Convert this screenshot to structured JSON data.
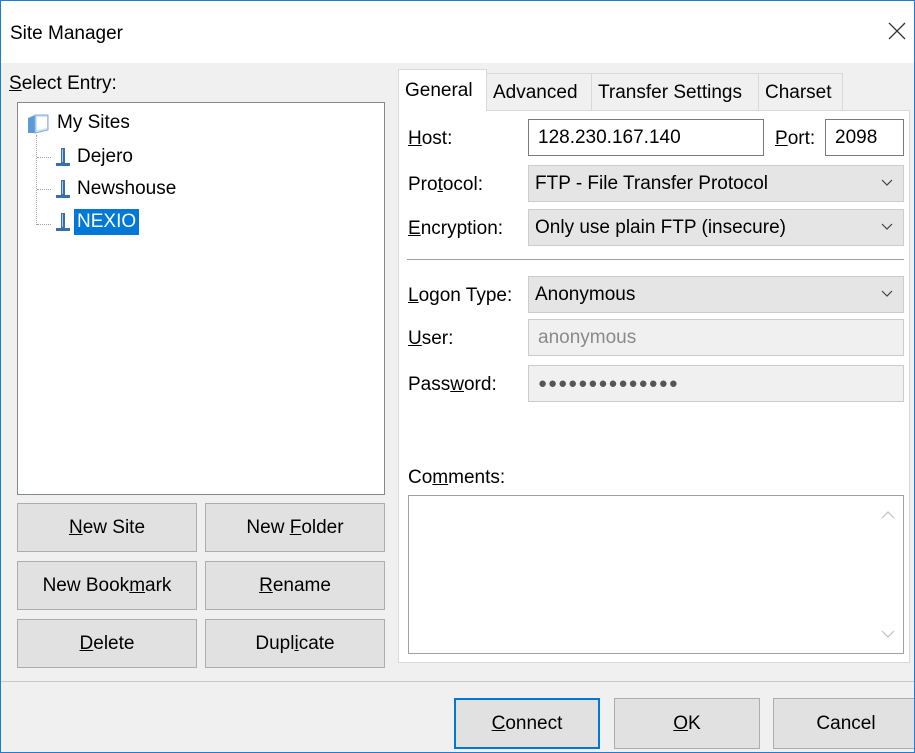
{
  "window": {
    "title": "Site Manager"
  },
  "left": {
    "select_entry_prefix": "S",
    "select_entry_rest": "elect Entry:",
    "tree": {
      "root": "My Sites",
      "items": [
        "Dejero",
        "Newshouse",
        "NEXIO"
      ],
      "selected": "NEXIO"
    },
    "buttons": {
      "new_site_u": "N",
      "new_site_rest": "ew Site",
      "new_folder_pre": "New ",
      "new_folder_u": "F",
      "new_folder_rest": "older",
      "new_bookmark_pre": "New Book",
      "new_bookmark_u": "m",
      "new_bookmark_rest": "ark",
      "rename_u": "R",
      "rename_rest": "ename",
      "delete_u": "D",
      "delete_rest": "elete",
      "duplicate_pre": "Dupl",
      "duplicate_u": "i",
      "duplicate_rest": "cate"
    }
  },
  "tabs": [
    "General",
    "Advanced",
    "Transfer Settings",
    "Charset"
  ],
  "general": {
    "host_u": "H",
    "host_rest": "ost:",
    "host_value": "128.230.167.140",
    "port_u": "P",
    "port_rest": "ort:",
    "port_value": "2098",
    "protocol_pre": "Pro",
    "protocol_u": "t",
    "protocol_rest": "ocol:",
    "protocol_value": "FTP - File Transfer Protocol",
    "encryption_u": "E",
    "encryption_rest": "ncryption:",
    "encryption_value": "Only use plain FTP (insecure)",
    "logon_u": "L",
    "logon_rest": "ogon Type:",
    "logon_value": "Anonymous",
    "user_u": "U",
    "user_rest": "ser:",
    "user_value": "anonymous",
    "password_pre": "Pass",
    "password_u": "w",
    "password_rest": "ord:",
    "password_value": "●●●●●●●●●●●●●●",
    "comments_pre": "Co",
    "comments_u": "m",
    "comments_rest": "ments:"
  },
  "footer": {
    "connect_u": "C",
    "connect_rest": "onnect",
    "ok_u": "O",
    "ok_rest": "K",
    "cancel": "Cancel"
  },
  "colors": {
    "selection": "#0078d7",
    "accent_border": "#0078d7"
  }
}
